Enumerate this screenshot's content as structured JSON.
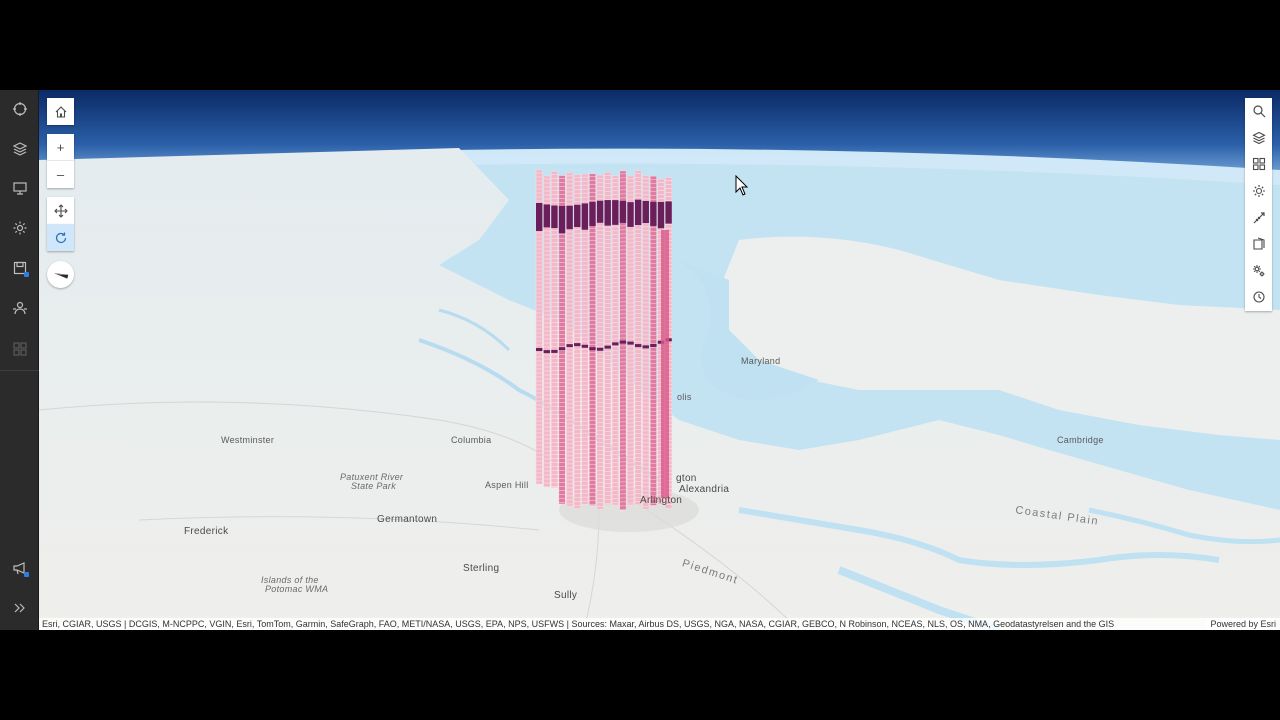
{
  "left_rail": {
    "items": [
      {
        "icon": "crosshair-icon"
      },
      {
        "icon": "layers-icon"
      },
      {
        "icon": "presentation-icon"
      },
      {
        "icon": "gear-icon"
      },
      {
        "icon": "save-icon"
      },
      {
        "icon": "share-icon"
      },
      {
        "icon": "grid-icon"
      }
    ],
    "bottom_items": [
      {
        "icon": "megaphone-icon"
      },
      {
        "icon": "expand-icon"
      }
    ]
  },
  "map_controls": {
    "home": {
      "icon": "home-icon"
    },
    "zoom_in": {
      "label": "+"
    },
    "zoom_out": {
      "label": "–"
    },
    "pan": {
      "icon": "pan-icon"
    },
    "rotate": {
      "icon": "rotate-icon"
    },
    "compass": {
      "icon": "compass-icon"
    }
  },
  "right_toolbar": {
    "items": [
      {
        "icon": "search-icon"
      },
      {
        "icon": "layers-icon"
      },
      {
        "icon": "basemap-icon"
      },
      {
        "icon": "daylight-icon"
      },
      {
        "icon": "measure-icon"
      },
      {
        "icon": "slice-icon"
      },
      {
        "icon": "settings-icon"
      },
      {
        "icon": "history-icon"
      }
    ]
  },
  "places": {
    "arlington": "Arlington",
    "alexandria": "Alexandria",
    "washington_partial": "gton",
    "germantown": "Germantown",
    "frederick": "Frederick",
    "columbia": "Columbia",
    "sterling": "Sterling",
    "sully": "Sully",
    "aspen_hill": "Aspen Hill",
    "islands_potomac": "Islands of the",
    "islands_potomac2": "Potomac WMA",
    "patuxent": "Patuxent River",
    "patuxent2": "State Park",
    "westminster": "Westminster",
    "maryland": "Maryland",
    "cambridge": "Cambridge",
    "coastal_plain": "Coastal Plain",
    "piedmont": "Piedmont",
    "annapolis_partial": "olis"
  },
  "attribution": {
    "text": "Esri, CGIAR, USGS | DCGIS, M-NCPPC, VGIN, Esri, TomTom, Garmin, SafeGraph, FAO, METI/NASA, USGS, EPA, NPS, USFWS | Sources: Maxar, Airbus DS, USGS, NGA, NASA, CGIAR, GEBCO, N Robinson, NCEAS, NLS, OS, NMA, Geodatastyrelsen and the GIS",
    "powered": "Powered by Esri"
  },
  "colors": {
    "sky_top": "#0d2f6e",
    "water": "#bfe2f3",
    "land": "#eeeeec",
    "bar_light": "#f2b8c8",
    "bar_mid": "#e07aa0",
    "bar_dark": "#6b1f5a",
    "accent": "#2f7de1"
  }
}
